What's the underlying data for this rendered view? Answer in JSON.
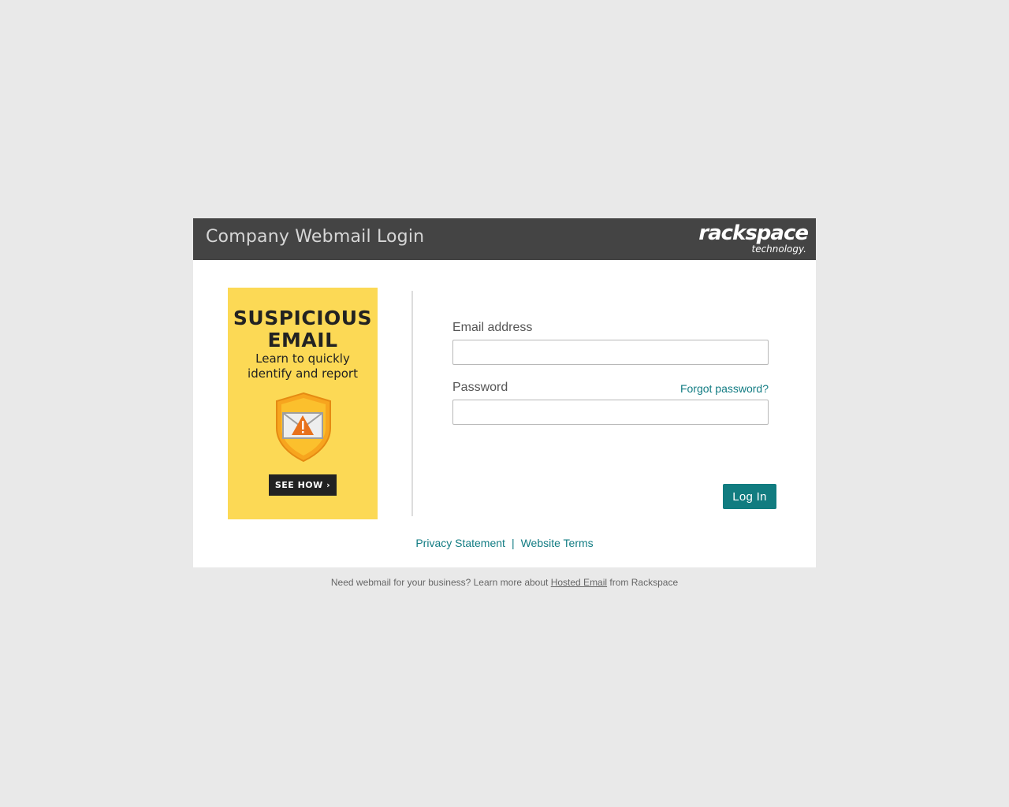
{
  "header": {
    "title": "Company Webmail Login",
    "logo_main": "rackspace",
    "logo_sub": "technology."
  },
  "ad": {
    "title_line1": "SUSPICIOUS",
    "title_line2": "EMAIL",
    "subtitle_line1": "Learn to quickly",
    "subtitle_line2": "identify and report",
    "button_label": "SEE HOW",
    "button_icon": "chevron-right-icon",
    "shield_icon": "warning-envelope-shield-icon",
    "background_color": "#fcd955"
  },
  "form": {
    "email_label": "Email address",
    "email_value": "",
    "password_label": "Password",
    "password_value": "",
    "forgot_link": "Forgot password?",
    "login_button": "Log In",
    "accent_color": "#117c80"
  },
  "footer": {
    "privacy": "Privacy Statement",
    "separator": "|",
    "terms": "Website Terms"
  },
  "bottom_note": {
    "prefix": "Need webmail for your business? Learn more about",
    "link": "Hosted Email",
    "suffix": "from Rackspace"
  }
}
